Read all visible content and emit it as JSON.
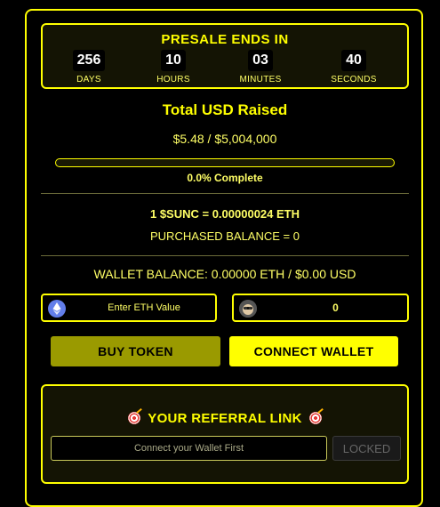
{
  "countdown": {
    "title": "PRESALE ENDS IN",
    "days": {
      "value": "256",
      "label": "DAYS"
    },
    "hours": {
      "value": "10",
      "label": "HOURS"
    },
    "minutes": {
      "value": "03",
      "label": "MINUTES"
    },
    "seconds": {
      "value": "40",
      "label": "SECONDS"
    }
  },
  "raised": {
    "title": "Total USD Raised",
    "amount": "$5.48 / $5,004,000",
    "progress_percent": 0,
    "progress_text": "0.0% Complete"
  },
  "token": {
    "rate": "1 $SUNC = 0.00000024 ETH",
    "purchased_balance": "PURCHASED BALANCE = 0",
    "wallet_balance": "WALLET BALANCE: 0.00000 ETH / $0.00 USD"
  },
  "inputs": {
    "eth_placeholder": "Enter ETH Value",
    "token_amount": "0",
    "eth_icon": "ethereum-icon",
    "token_icon": "sunc-token-icon"
  },
  "buttons": {
    "buy": "BUY TOKEN",
    "connect": "CONNECT WALLET"
  },
  "referral": {
    "title": "YOUR REFERRAL LINK",
    "icon": "target-icon",
    "placeholder": "Connect your Wallet First",
    "locked": "LOCKED"
  },
  "colors": {
    "accent": "#ffff00",
    "background": "#000000",
    "buy_button": "#9a9a00",
    "eth_blue": "#627eea"
  }
}
